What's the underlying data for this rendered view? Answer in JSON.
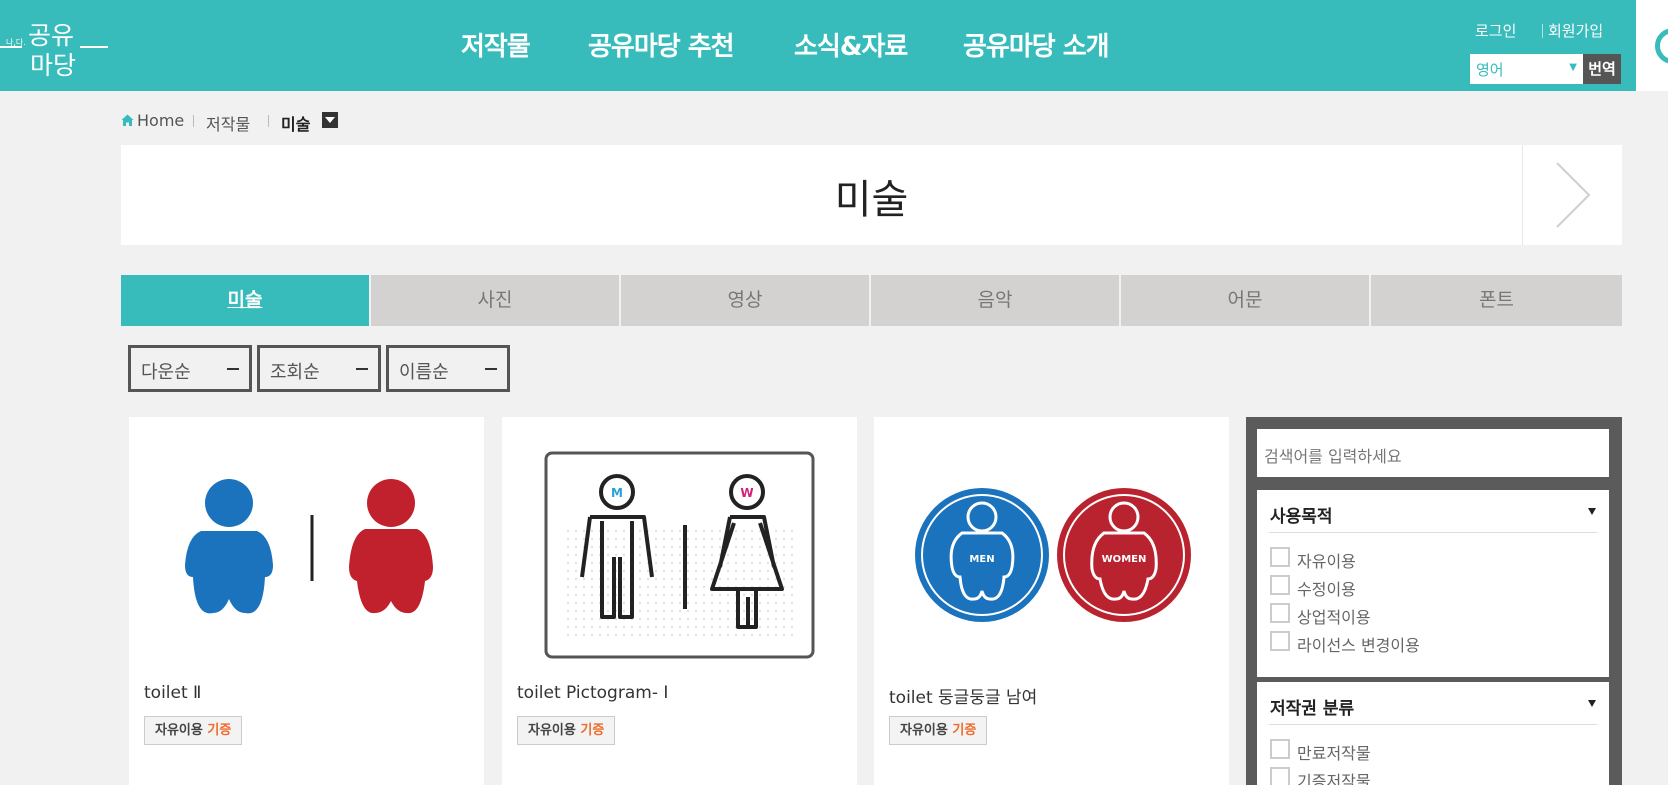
{
  "header": {
    "logo_text": "공유마당",
    "nav": [
      "저작물",
      "공유마당 추천",
      "소식&자료",
      "공유마당 소개"
    ],
    "login": "로그인",
    "signup": "회원가입",
    "language_selected": "영어",
    "translate_label": "번역"
  },
  "breadcrumb": {
    "home": "Home",
    "level1": "저작물",
    "current": "미술"
  },
  "page_title": "미술",
  "tabs": [
    "미술",
    "사진",
    "영상",
    "음악",
    "어문",
    "폰트"
  ],
  "active_tab": "미술",
  "sort_options": [
    "다운순",
    "조회순",
    "이름순"
  ],
  "cards": [
    {
      "title": "toilet Ⅱ",
      "badge_use": "자유이용",
      "badge_type": "기증"
    },
    {
      "title": "toilet Pictogram- Ⅰ",
      "badge_use": "자유이용",
      "badge_type": "기증"
    },
    {
      "title": "toilet 둥글둥글 남여",
      "badge_use": "자유이용",
      "badge_type": "기증"
    }
  ],
  "card_image_labels": {
    "card2_men": "M",
    "card2_women": "W",
    "card3_men": "MEN",
    "card3_women": "WOMEN"
  },
  "sidebar": {
    "search_placeholder": "검색어를 입력하세요",
    "facets": [
      {
        "title": "사용목적",
        "options": [
          "자유이용",
          "수정이용",
          "상업적이용",
          "라이선스 변경이용"
        ]
      },
      {
        "title": "저작권 분류",
        "options": [
          "만료저작물",
          "기증저작물"
        ]
      }
    ]
  },
  "colors": {
    "brand": "#37bbbb",
    "tab_inactive": "#d3d2d0",
    "men_blue": "#1b73bd",
    "women_red": "#c0212c",
    "donate_orange": "#ef6a2b"
  },
  "icons": [
    "home-icon",
    "chevron-right-icon",
    "dropdown-caret-icon",
    "minus-icon",
    "checkbox-icon"
  ]
}
